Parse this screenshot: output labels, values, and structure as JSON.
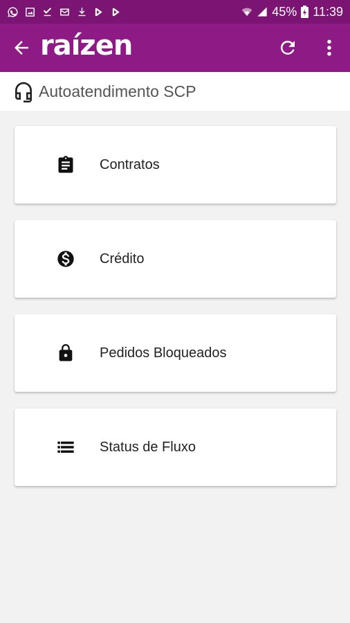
{
  "status_bar": {
    "battery": "45%",
    "time": "11:39"
  },
  "app_bar": {
    "logo_text": "raízen",
    "icons": [
      "arrow-back-icon",
      "refresh-icon",
      "more-vert-icon"
    ]
  },
  "subheader": {
    "title": "Autoatendimento SCP",
    "icon": "headset-icon"
  },
  "menu": {
    "items": [
      {
        "label": "Contratos",
        "icon": "clipboard-icon"
      },
      {
        "label": "Crédito",
        "icon": "dollar-circle-icon"
      },
      {
        "label": "Pedidos Bloqueados",
        "icon": "lock-icon"
      },
      {
        "label": "Status de Fluxo",
        "icon": "list-icon"
      }
    ]
  },
  "colors": {
    "app_bar": "#8e1a86",
    "status_bar": "#7b1472",
    "background": "#f2f2f2"
  }
}
